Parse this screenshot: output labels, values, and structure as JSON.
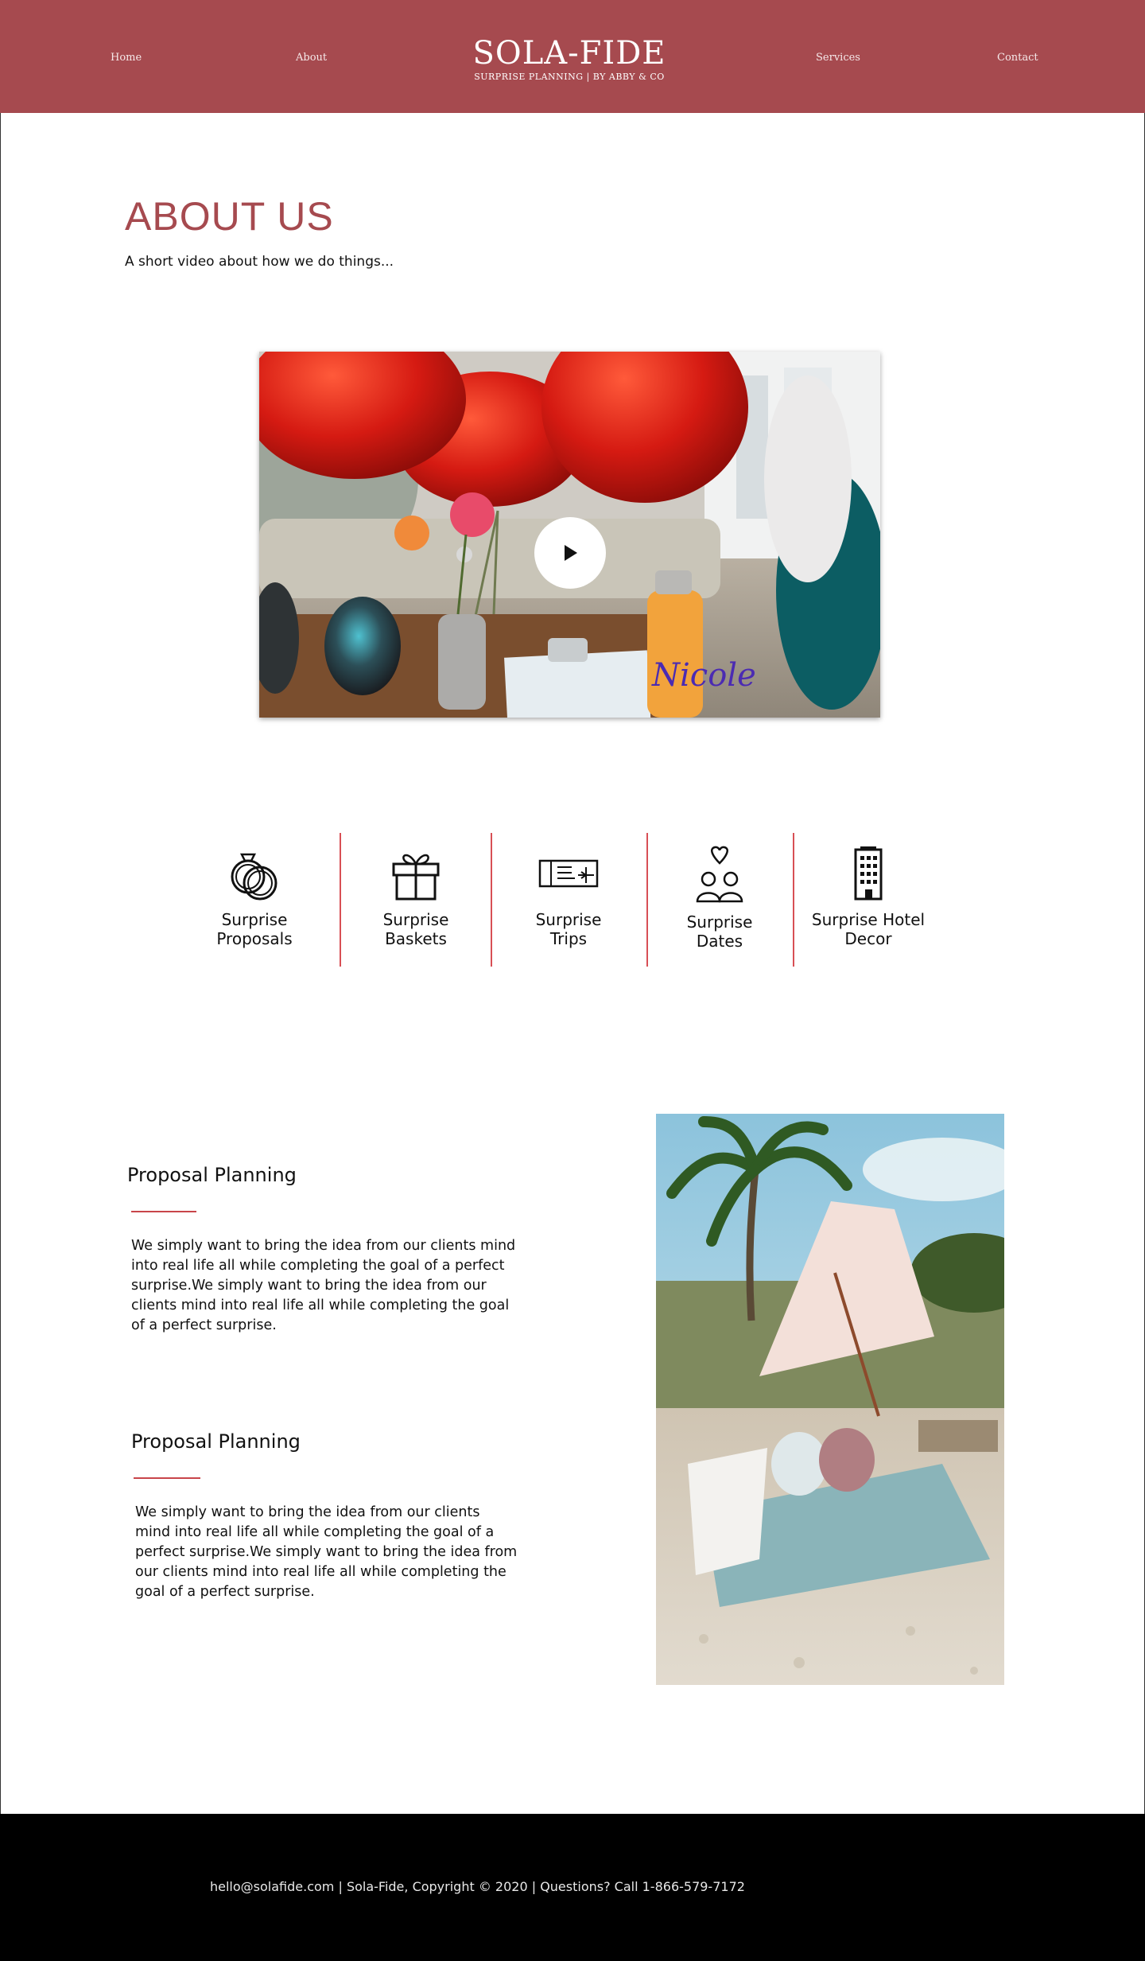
{
  "header": {
    "nav": [
      "Home",
      "About",
      "Services",
      "Contact"
    ],
    "brand_name": "SOLA-FIDE",
    "brand_tagline": "SURPRISE PLANNING | BY ABBY & CO",
    "background_color": "#a64a4f"
  },
  "about": {
    "title": "ABOUT US",
    "subtitle": "A short video about how we do things..."
  },
  "video": {
    "bottle_text": "Nicole",
    "play_icon": "play-icon"
  },
  "services": [
    {
      "line1": "Surprise",
      "line2": "Proposals",
      "icon": "rings-icon"
    },
    {
      "line1": "Surprise",
      "line2": "Baskets",
      "icon": "gift-icon"
    },
    {
      "line1": "Surprise",
      "line2": "Trips",
      "icon": "ticket-icon"
    },
    {
      "line1": "Surprise",
      "line2": "Dates",
      "icon": "couple-heart-icon"
    },
    {
      "line1": "Surprise Hotel",
      "line2": "Decor",
      "icon": "hotel-icon"
    }
  ],
  "planning": [
    {
      "title": "Proposal Planning",
      "lines": [
        "We simply want to bring the idea from our clients mind",
        "into real life all while completing the goal of a perfect",
        "surprise.We simply want to bring the idea from our",
        "clients mind into real life all while completing the goal",
        "of a perfect surprise."
      ]
    },
    {
      "title": "Proposal Planning",
      "lines": [
        "We simply want to bring the idea from our clients",
        "mind into real life all while completing the goal of a",
        "perfect surprise.We simply want to bring the idea from",
        "our clients mind into real life all while completing the",
        "goal of a perfect surprise."
      ]
    }
  ],
  "footer": {
    "text": "hello@solafide.com | Sola-Fide, Copyright © 2020 | Questions? Call 1-866-579-7172"
  },
  "colors": {
    "accent": "#a64a4f",
    "divider": "#d84f55",
    "footer_bg": "#000000"
  }
}
